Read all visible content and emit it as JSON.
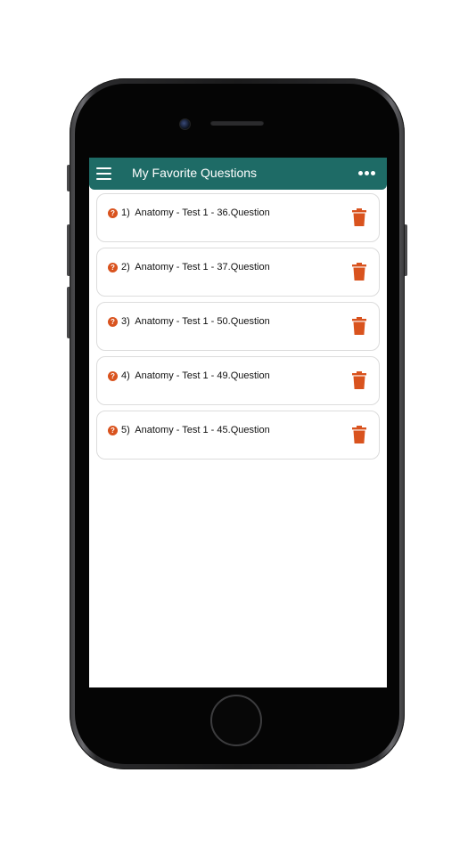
{
  "app_bar": {
    "title": "My Favorite Questions",
    "menu_icon": "hamburger-menu-icon",
    "more_icon": "more-horizontal-icon",
    "background": "#1e6b66"
  },
  "favorites": [
    {
      "number": "1)",
      "label": "Anatomy - Test 1 - 36.Question"
    },
    {
      "number": "2)",
      "label": "Anatomy - Test 1 - 37.Question"
    },
    {
      "number": "3)",
      "label": "Anatomy - Test 1 - 50.Question"
    },
    {
      "number": "4)",
      "label": "Anatomy - Test 1 - 49.Question"
    },
    {
      "number": "5)",
      "label": "Anatomy - Test 1 - 45.Question"
    }
  ],
  "item_icons": {
    "leading": "question-circle-icon",
    "trailing": "trash-icon",
    "accent": "#d9531e"
  }
}
